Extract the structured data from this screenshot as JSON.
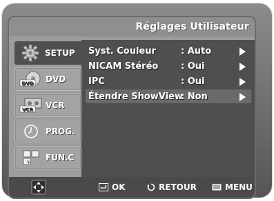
{
  "header": {
    "title": "Réglages Utilisateur"
  },
  "sidebar": {
    "items": [
      {
        "label": "SETUP",
        "icon": "gear-icon",
        "active": true
      },
      {
        "label": "DVD",
        "icon": "dvd-disc-icon",
        "badge": "DVD"
      },
      {
        "label": "VCR",
        "icon": "vcr-cassette-icon",
        "badge": "VCR"
      },
      {
        "label": "PROG.",
        "icon": "clock-icon"
      },
      {
        "label": "FUN.C",
        "icon": "function-blocks-icon"
      }
    ]
  },
  "menu": {
    "rows": [
      {
        "name": "Syst. Couleur",
        "value": ": Auto"
      },
      {
        "name": "NICAM Stéréo",
        "value": ": Oui"
      },
      {
        "name": "IPC",
        "value": ": Oui"
      },
      {
        "name": "Étendre ShowView",
        "value": ": Non",
        "selected": true
      }
    ]
  },
  "footer": {
    "ok_label": "OK",
    "return_label": "RETOUR",
    "menu_label": "MENU"
  },
  "colors": {
    "panel": "#4f4f4f",
    "sidebar_button": "#a3a3a3",
    "text": "#ffffff",
    "selected_row": "#6a6a6a"
  }
}
